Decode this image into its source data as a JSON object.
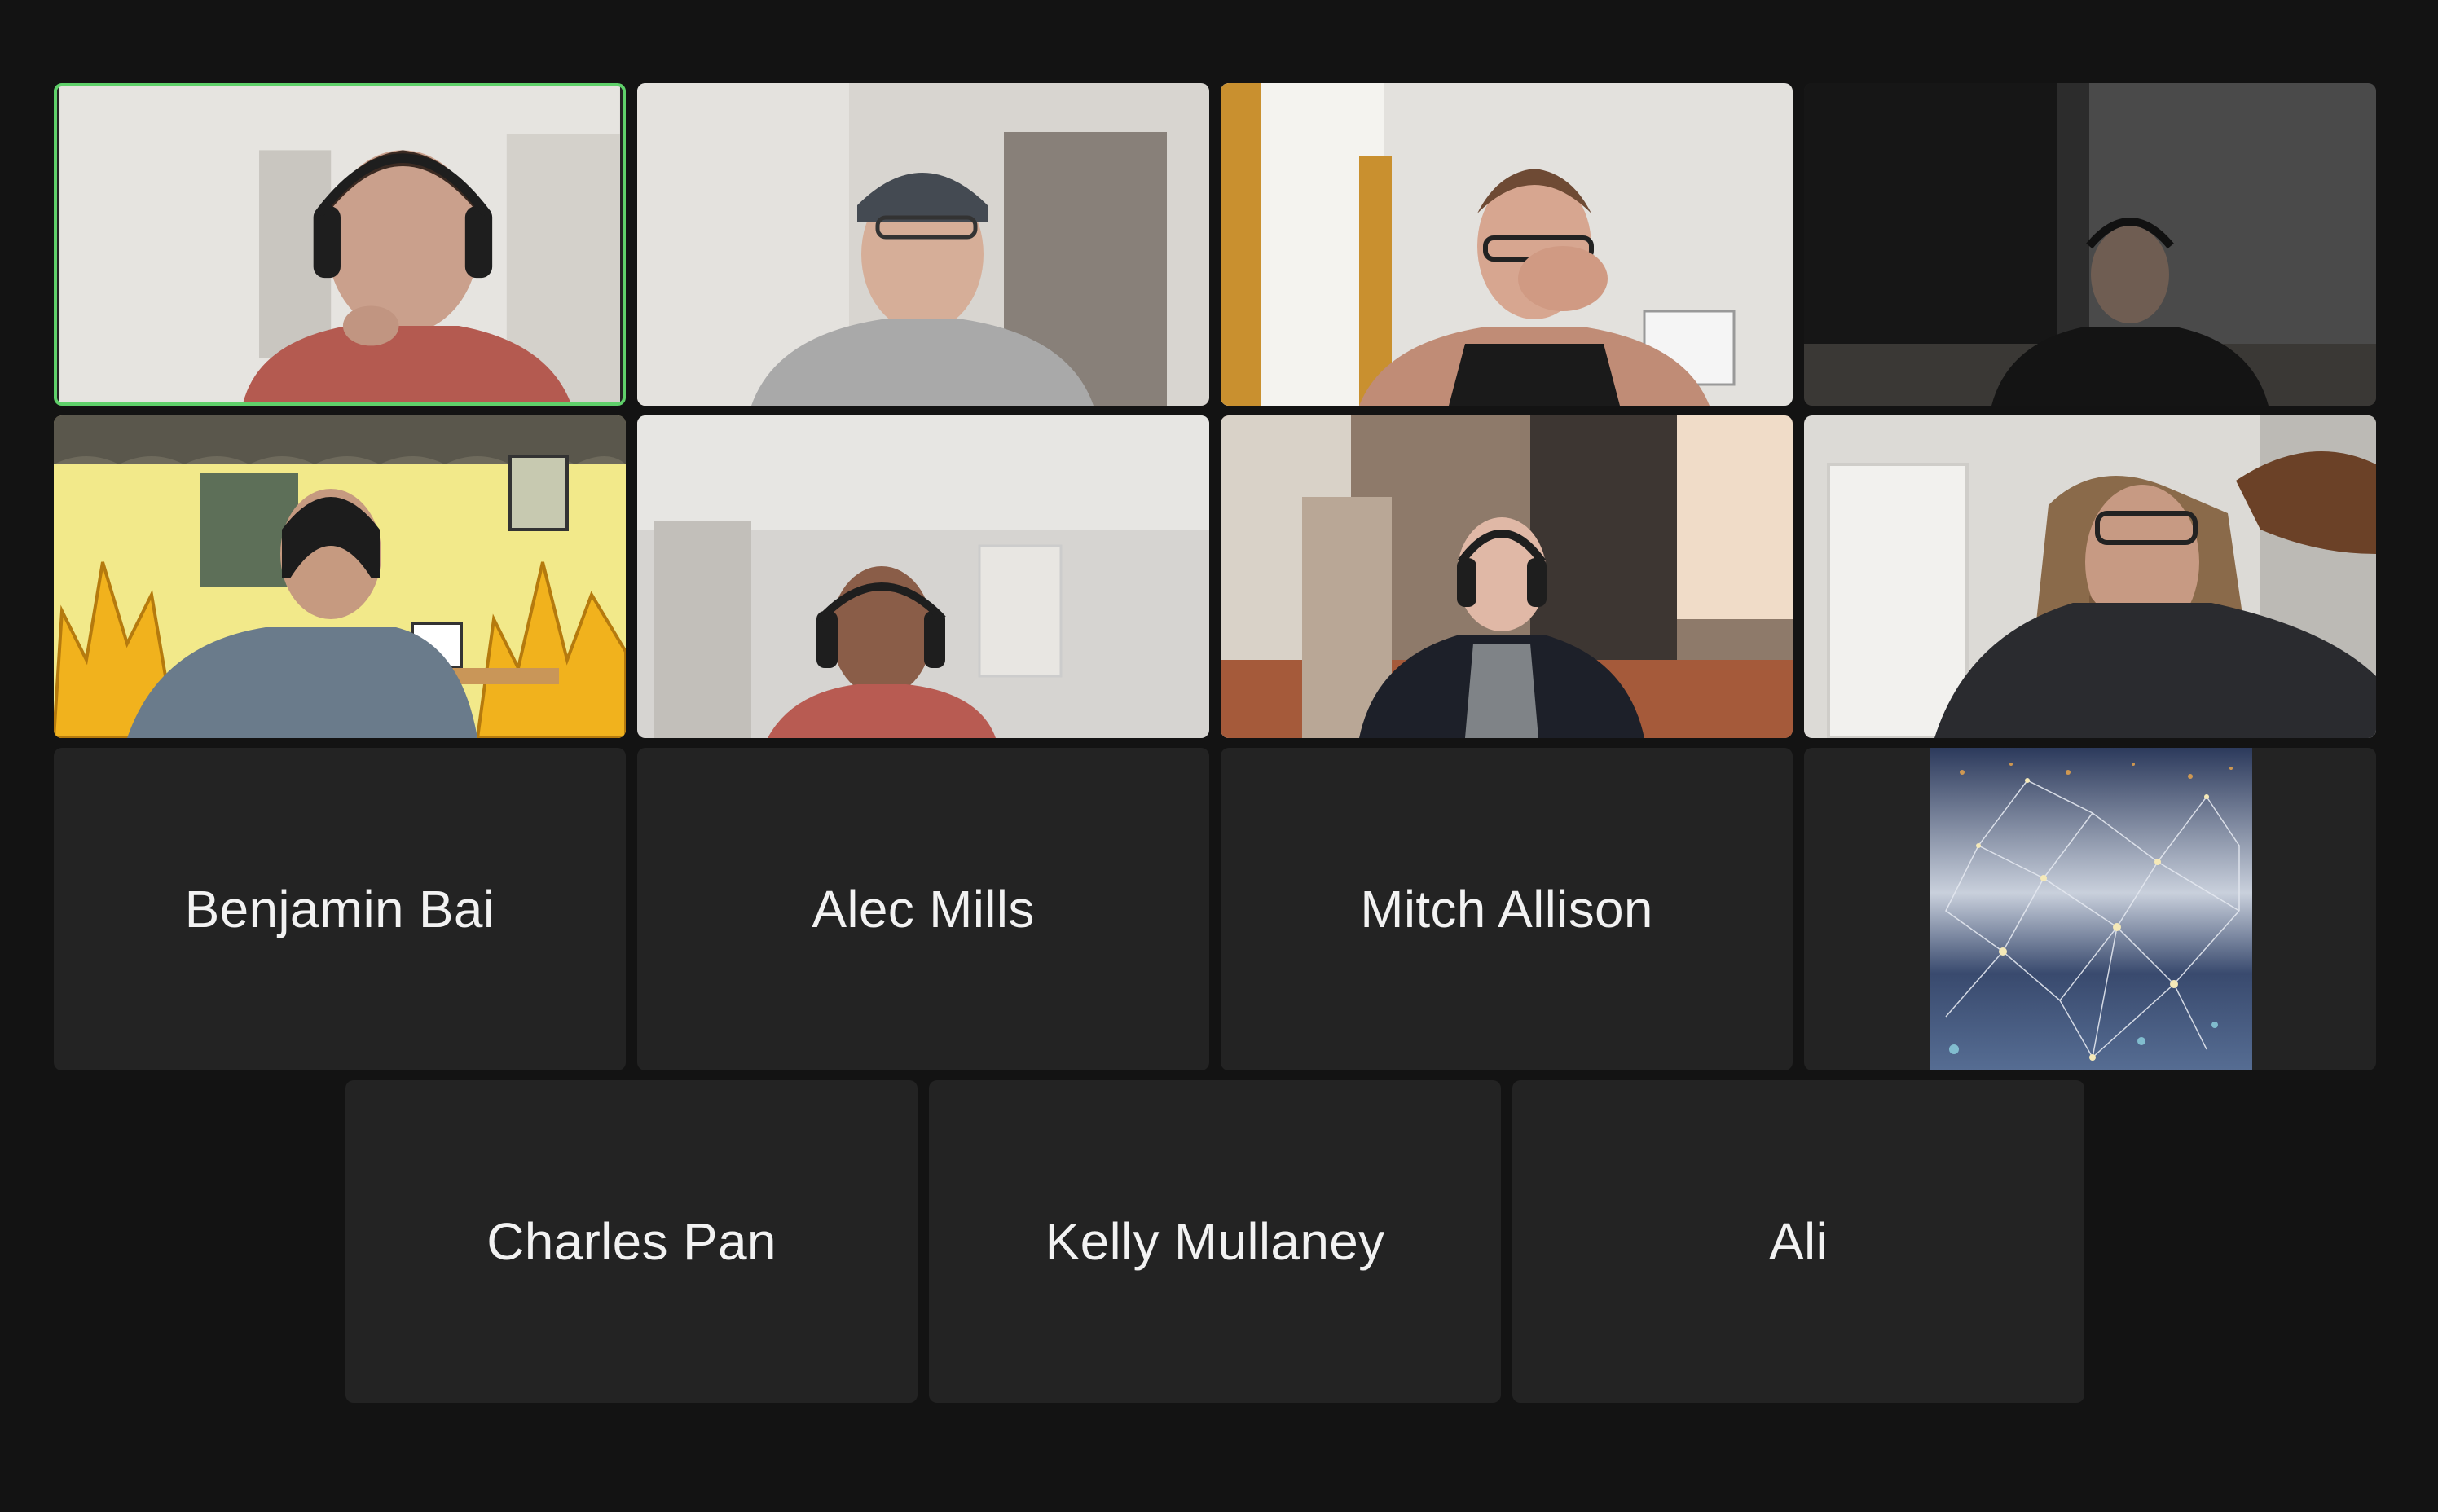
{
  "meeting": {
    "layout": "gallery-view",
    "active_speaker_color": "#5fd06a",
    "background_color": "#131313",
    "tile_color": "#232323"
  },
  "participants": [
    {
      "name": "",
      "video": "on",
      "active_speaker": true
    },
    {
      "name": "",
      "video": "on"
    },
    {
      "name": "",
      "video": "on"
    },
    {
      "name": "",
      "video": "on"
    },
    {
      "name": "",
      "video": "on",
      "virtual_background": "fire-meme"
    },
    {
      "name": "",
      "video": "on"
    },
    {
      "name": "",
      "video": "on"
    },
    {
      "name": "",
      "video": "on"
    },
    {
      "name": "Benjamin Bai",
      "video": "off"
    },
    {
      "name": "Alec Mills",
      "video": "off"
    },
    {
      "name": "Mitch Allison",
      "video": "off"
    },
    {
      "name": "",
      "video": "off",
      "profile_picture": "network-abstract"
    },
    {
      "name": "Charles Pan",
      "video": "off"
    },
    {
      "name": "Kelly Mullaney",
      "video": "off"
    },
    {
      "name": "Ali",
      "video": "off"
    }
  ]
}
